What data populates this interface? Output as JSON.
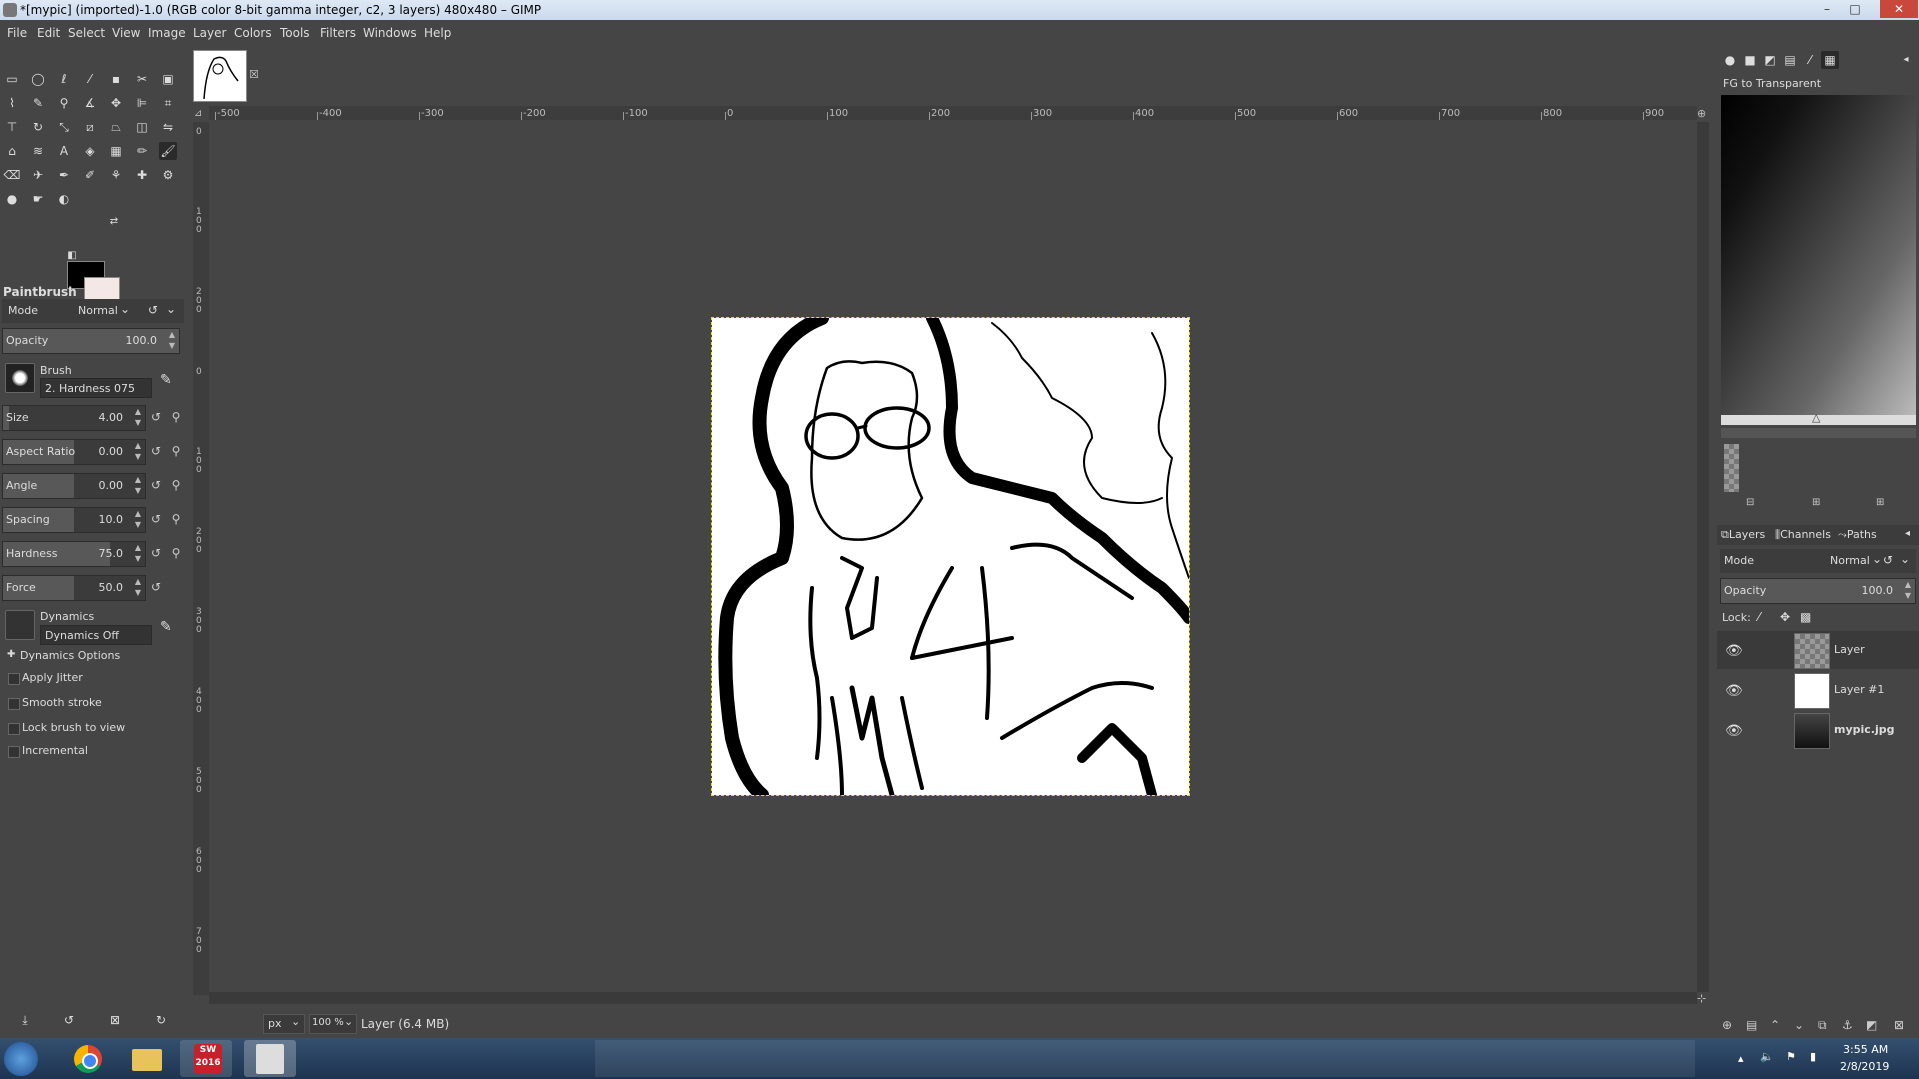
{
  "window": {
    "title": "*[mypic] (imported)-1.0 (RGB color 8-bit gamma integer, c2, 3 layers) 480x480 – GIMP",
    "minimize": "–",
    "maximize": "□",
    "close": "✕"
  },
  "menu": [
    "File",
    "Edit",
    "Select",
    "View",
    "Image",
    "Layer",
    "Colors",
    "Tools",
    "Filters",
    "Windows",
    "Help"
  ],
  "toolbox": {
    "tool_name": "Paintbrush",
    "mode_label": "Mode",
    "mode_value": "Normal",
    "opacity_label": "Opacity",
    "opacity_value": "100.0",
    "opacity_fraction": 1.0,
    "brush_label": "Brush",
    "brush_value": "2. Hardness 075",
    "sliders": [
      {
        "label": "Size",
        "value": "4.00",
        "fraction": 0.04
      },
      {
        "label": "Aspect Ratio",
        "value": "0.00",
        "fraction": 0.5
      },
      {
        "label": "Angle",
        "value": "0.00",
        "fraction": 0.5
      },
      {
        "label": "Spacing",
        "value": "10.0",
        "fraction": 0.5
      },
      {
        "label": "Hardness",
        "value": "75.0",
        "fraction": 0.75
      },
      {
        "label": "Force",
        "value": "50.0",
        "fraction": 0.5
      }
    ],
    "dynamics_label": "Dynamics",
    "dynamics_value": "Dynamics Off",
    "dynamics_options": "Dynamics Options",
    "checkboxes": [
      "Apply Jitter",
      "Smooth stroke",
      "Lock brush to view",
      "Incremental"
    ]
  },
  "rulers": {
    "h": [
      "-500",
      "-400",
      "-300",
      "-200",
      "-100",
      "0",
      "100",
      "200",
      "300",
      "400",
      "500",
      "600",
      "700",
      "800",
      "900"
    ],
    "v": [
      "0",
      "1\n0\n0",
      "2\n0\n0",
      "0",
      "1\n0\n0",
      "2\n0\n0",
      "3\n0\n0",
      "4\n0\n0",
      "5\n0\n0",
      "6\n0\n0",
      "7\n0\n0"
    ]
  },
  "statusbar": {
    "unit": "px",
    "zoom": "100 %",
    "info": "Layer (6.4 MB)"
  },
  "dock": {
    "gradient_name": "FG to Transparent",
    "tabs": [
      "Layers",
      "Channels",
      "Paths"
    ],
    "mode_label": "Mode",
    "mode_value": "Normal",
    "opacity_label": "Opacity",
    "opacity_value": "100.0",
    "lock_label": "Lock:",
    "layers": [
      {
        "name": "Layer"
      },
      {
        "name": "Layer #1"
      },
      {
        "name": "mypic.jpg"
      }
    ]
  },
  "taskbar": {
    "sw_label": "SW 2016",
    "time": "3:55 AM",
    "date": "2/8/2019"
  },
  "colors": {
    "foreground": "#000000",
    "background": "#f3e8e5",
    "ui_bg": "#454545"
  }
}
